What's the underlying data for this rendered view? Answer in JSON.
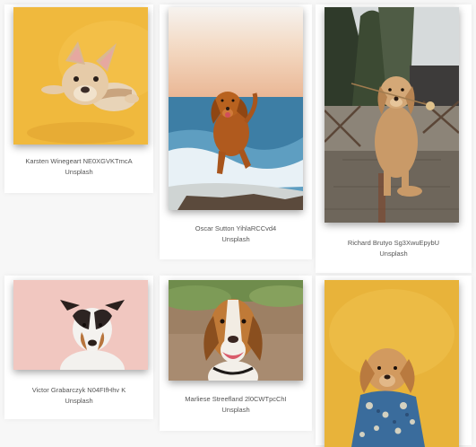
{
  "gallery": {
    "photos": [
      {
        "credit": "Karsten Winegeart NE0XGVKTmcA",
        "source": "Unsplash",
        "subject": "french bulldog on yellow background"
      },
      {
        "credit": "Oscar Sutton YihlaRCCvd4",
        "source": "Unsplash",
        "subject": "golden retriever running on beach"
      },
      {
        "credit": "Richard Brutyo Sg3XwuEpybU",
        "source": "Unsplash",
        "subject": "golden retriever holding flower"
      },
      {
        "credit": "Victor Grabarczyk N04FIfHhv K",
        "source": "Unsplash",
        "subject": "jack russell terrier on pink background"
      },
      {
        "credit": "Marliese Streefland 2l0CWTpcChI",
        "source": "Unsplash",
        "subject": "beagle smiling outdoors"
      },
      {
        "credit": "",
        "source": "",
        "subject": "small dog in patterned shirt on yellow background"
      }
    ]
  }
}
